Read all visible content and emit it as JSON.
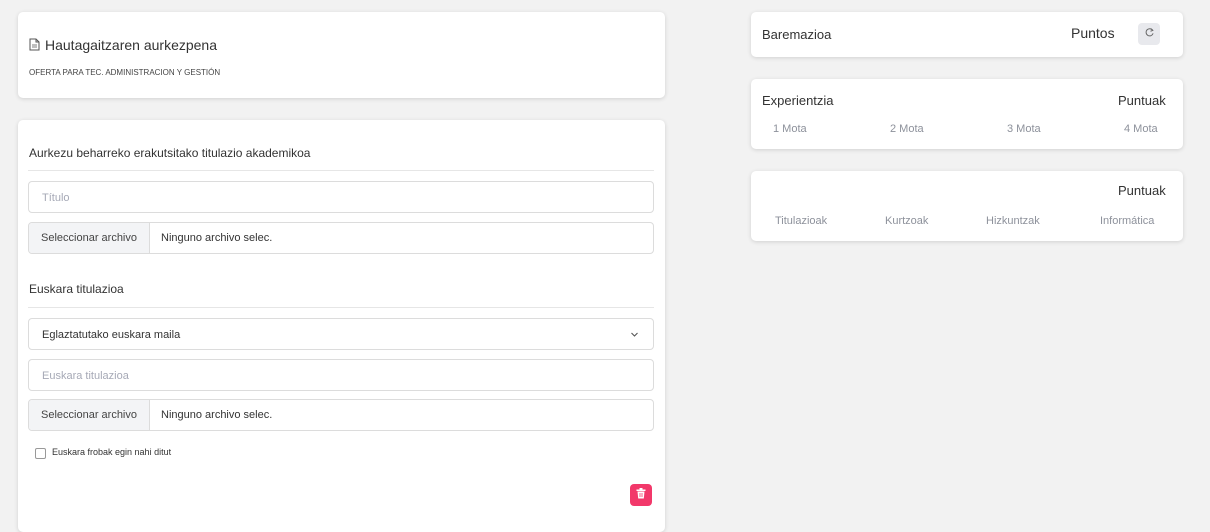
{
  "presentation": {
    "title": "Hautagaitzaren aurkezpena",
    "subtitle": "OFERTA PARA TEC. ADMINISTRACION Y GESTIÓN",
    "icon": "document-icon"
  },
  "academic": {
    "heading": "Aurkezu beharreko erakutsitako titulazio akademikoa",
    "title_placeholder": "Título",
    "file_button": "Seleccionar archivo",
    "file_name": "Ninguno archivo selec."
  },
  "euskara": {
    "heading": "Euskara titulazioa",
    "level_select": "Eglaztatutako euskara maila",
    "title_placeholder": "Euskara titulazioa",
    "file_button": "Seleccionar archivo",
    "file_name": "Ninguno archivo selec.",
    "checkbox_label": "Euskara frobak egin nahi ditut",
    "checkbox_checked": false
  },
  "baremazioa": {
    "title": "Baremazioa",
    "points_label": "Puntos",
    "refresh_icon": "refresh-icon"
  },
  "experientzia": {
    "title": "Experientzia",
    "points_label": "Puntuak",
    "columns": [
      "1 Mota",
      "2 Mota",
      "3 Mota",
      "4 Mota"
    ]
  },
  "formakuntza": {
    "points_label": "Puntuak",
    "columns": [
      "Titulazioak",
      "Kurtzoak",
      "Hizkuntzak",
      "Informática"
    ]
  },
  "colors": {
    "background": "#f2f2f2",
    "delete_button": "#f2386a",
    "placeholder": "#a6a9b6"
  }
}
